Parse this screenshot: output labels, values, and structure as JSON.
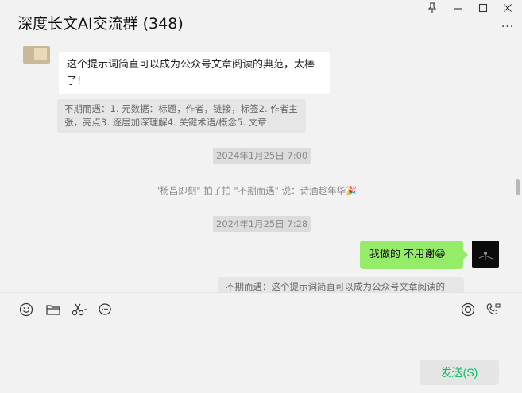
{
  "header": {
    "title": "深度长文AI交流群 (348)",
    "more_glyph": "···"
  },
  "messages": {
    "incoming_text": "这个提示词简直可以成为公众号文章阅读的典范，太棒了!",
    "quote1": "不期而遇：1. 元数据：标题，作者，链接，标签2. 作者主张，亮点3. 逐层加深理解4. 关键术语/概念5. 文章",
    "timestamp1": "2024年1月25日 7:00",
    "system_notice": "\"杨昌即刻\" 拍了拍 \"不期而遇\" 说：诗酒趁年华🎉",
    "timestamp2": "2024年1月25日 7:28",
    "outgoing_text": "我做的 不用谢😁",
    "quote2": "不期而遇：这个提示词简直可以成为公众号文章阅读的"
  },
  "input": {
    "send_label": "发送(S)"
  },
  "colors": {
    "background": "#f2f2f2",
    "outgoing_bubble": "#95ec69",
    "send_text": "#07c160"
  },
  "icons": [
    "pin-icon",
    "minimize-icon",
    "maximize-icon",
    "close-icon",
    "more-icon",
    "emoji-icon",
    "folder-icon",
    "scissors-icon",
    "chat-history-icon",
    "voice-call-icon",
    "video-call-icon"
  ]
}
